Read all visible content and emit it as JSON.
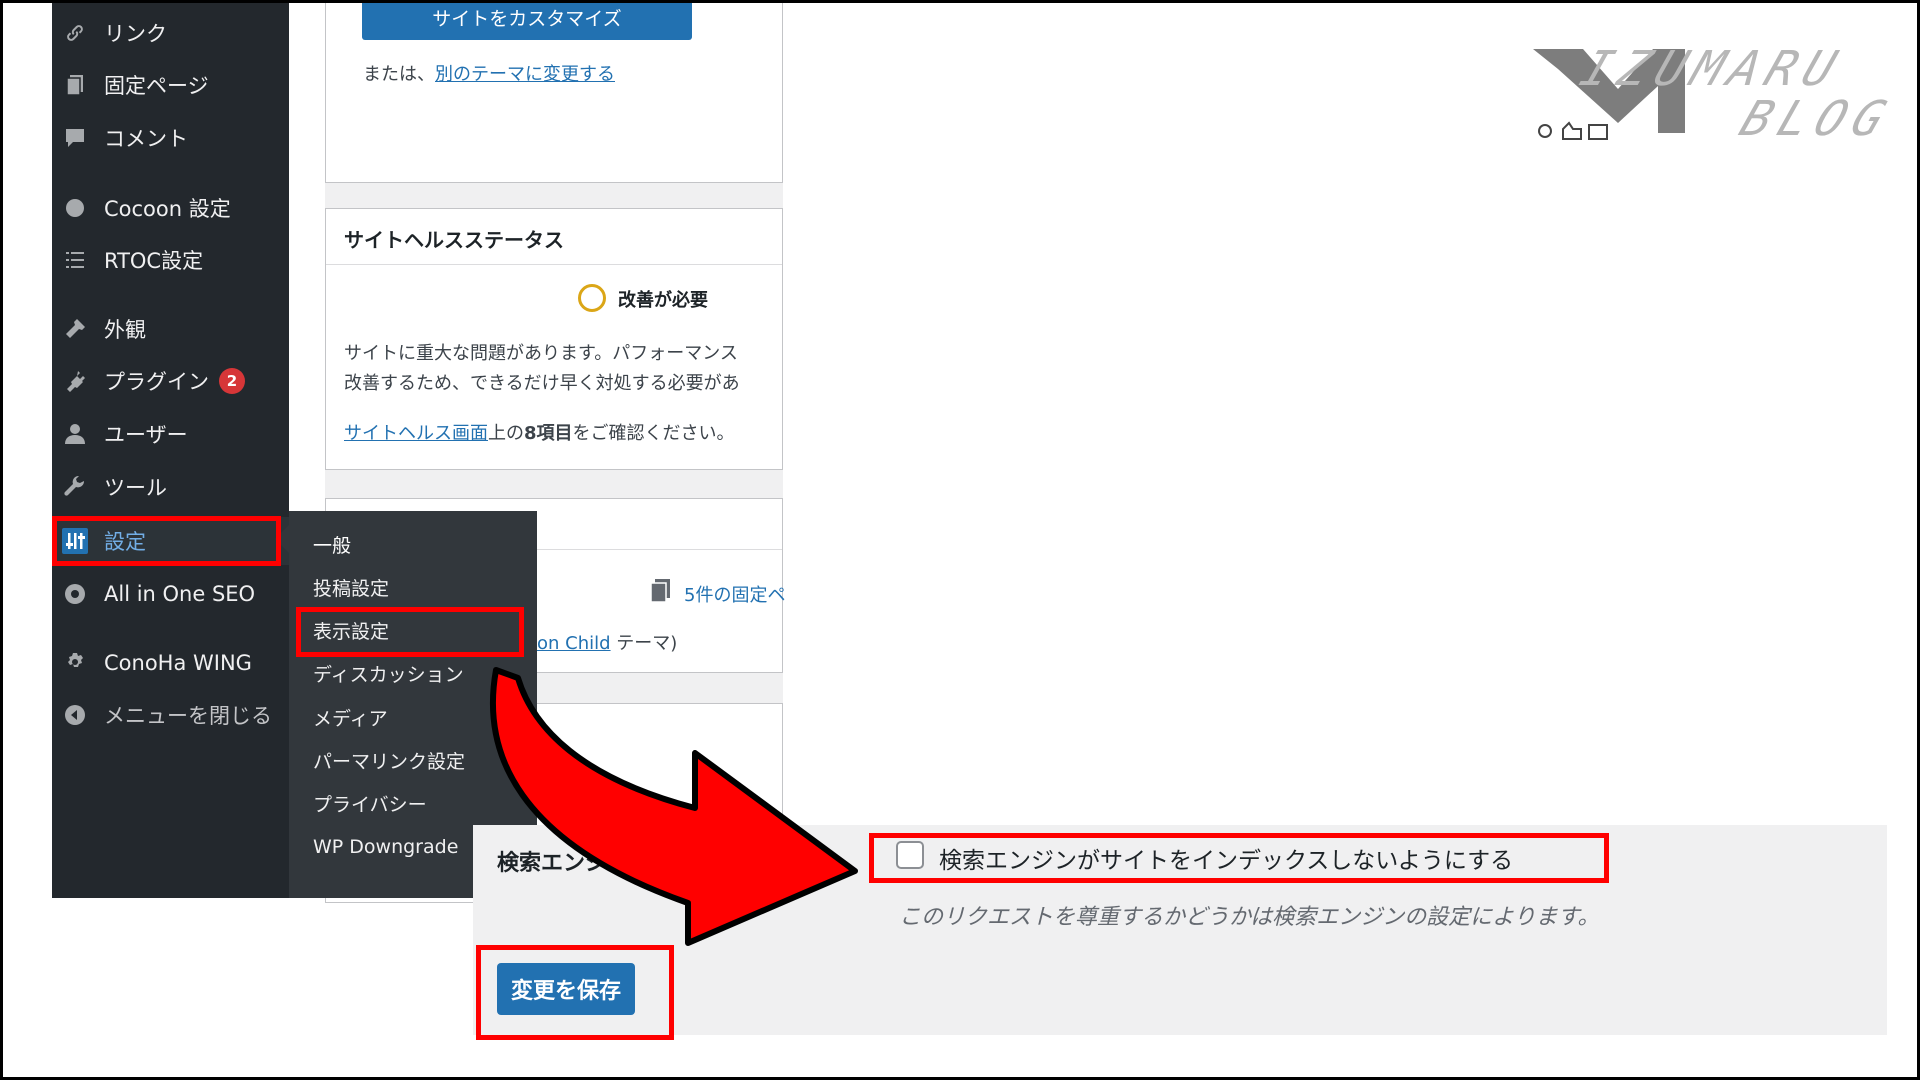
{
  "sidebar": {
    "items": [
      {
        "label": "リンク",
        "icon": "link-icon"
      },
      {
        "label": "固定ページ",
        "icon": "pages-icon"
      },
      {
        "label": "コメント",
        "icon": "comment-icon"
      },
      {
        "label": "Cocoon 設定",
        "icon": "circle-icon"
      },
      {
        "label": "RTOC設定",
        "icon": "list-icon"
      },
      {
        "label": "外観",
        "icon": "appearance-icon"
      },
      {
        "label": "プラグイン",
        "icon": "plugin-icon",
        "badge": "2"
      },
      {
        "label": "ユーザー",
        "icon": "user-icon"
      },
      {
        "label": "ツール",
        "icon": "wrench-icon"
      },
      {
        "label": "設定",
        "icon": "settings-icon",
        "current": true
      },
      {
        "label": "All in One SEO",
        "icon": "aioseo-icon"
      },
      {
        "label": "ConoHa WING",
        "icon": "gear-icon"
      },
      {
        "label": "メニューを閉じる",
        "icon": "collapse-icon"
      }
    ]
  },
  "submenu": {
    "items": [
      {
        "label": "一般"
      },
      {
        "label": "投稿設定"
      },
      {
        "label": "表示設定",
        "highlighted": true
      },
      {
        "label": "ディスカッション"
      },
      {
        "label": "メディア"
      },
      {
        "label": "パーマリンク設定"
      },
      {
        "label": "プライバシー"
      },
      {
        "label": "WP Downgrade"
      }
    ]
  },
  "theme_card": {
    "button_label": "サイトをカスタマイズ",
    "or_text": "または、",
    "change_theme_link": "別のテーマに変更する"
  },
  "health_card": {
    "title": "サイトヘルスステータス",
    "status": "改善が必要",
    "desc_line1": "サイトに重大な問題があります。パフォーマンス",
    "desc_line2": "改善するため、できるだけ早く対処する必要があ",
    "link": "サイトヘルス画面",
    "after_link_1": "上の",
    "items_count": "8項目",
    "after_link_2": "をご確認ください。"
  },
  "glance_card": {
    "pages_count": "5件の固定ペ",
    "theme_link": "oon Child",
    "theme_suffix": " テーマ)"
  },
  "settings": {
    "row_label": "検索エンジ",
    "checkbox_label": "検索エンジンがサイトをインデックスしないようにする",
    "checkbox_checked": false,
    "description": "このリクエストを尊重するかどうかは検索エンジンの設定によります。",
    "save_label": "変更を保存"
  },
  "logo": {
    "text_top": "IZUMARU",
    "text_bottom": "BLOG"
  },
  "colors": {
    "highlight": "#ff0000",
    "wp_blue": "#2271b1",
    "sidebar_bg": "#23282d",
    "submenu_bg": "#32373c"
  }
}
